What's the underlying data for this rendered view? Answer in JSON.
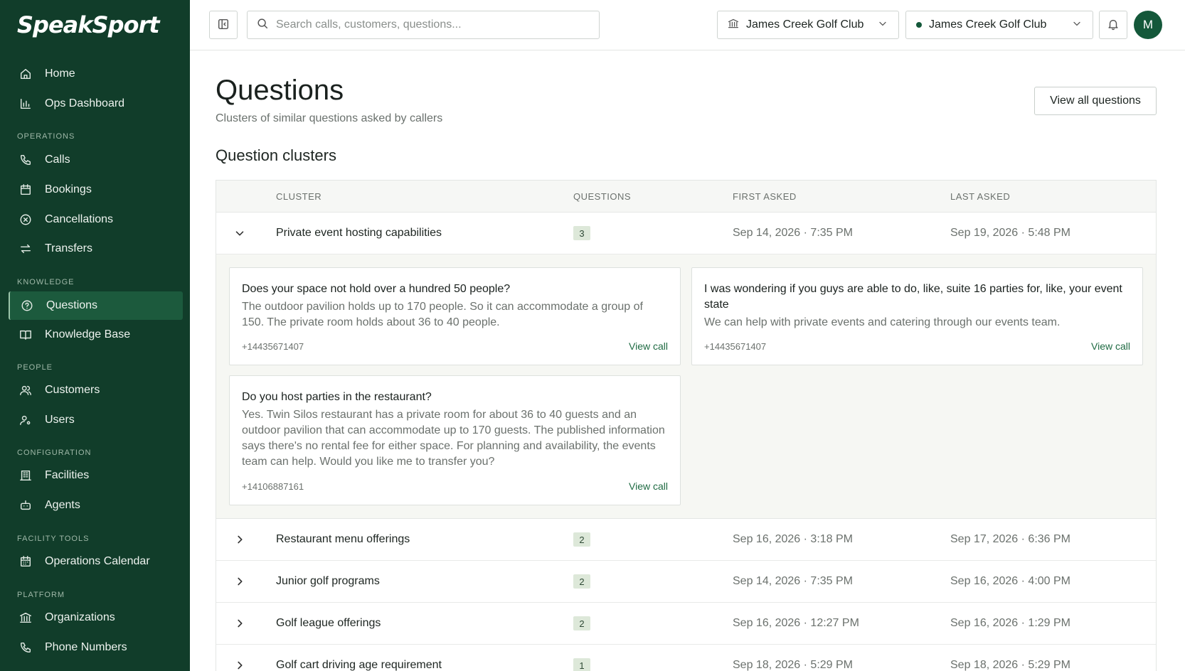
{
  "sidebar": {
    "logo": "SpeakSport",
    "items": [
      {
        "label": "Home",
        "icon": "home-icon"
      },
      {
        "label": "Ops Dashboard",
        "icon": "chart-icon"
      },
      {
        "label": "Calls",
        "icon": "phone-icon"
      },
      {
        "label": "Bookings",
        "icon": "calendar-icon"
      },
      {
        "label": "Cancellations",
        "icon": "x-circle-icon"
      },
      {
        "label": "Transfers",
        "icon": "arrows-icon"
      },
      {
        "label": "Questions",
        "icon": "question-icon"
      },
      {
        "label": "Knowledge Base",
        "icon": "book-icon"
      },
      {
        "label": "Customers",
        "icon": "users-icon"
      },
      {
        "label": "Users",
        "icon": "user-gear-icon"
      },
      {
        "label": "Facilities",
        "icon": "building-icon"
      },
      {
        "label": "Agents",
        "icon": "robot-icon"
      },
      {
        "label": "Operations Calendar",
        "icon": "calendar-grid-icon"
      },
      {
        "label": "Organizations",
        "icon": "bank-icon"
      },
      {
        "label": "Phone Numbers",
        "icon": "phone-icon"
      }
    ],
    "sections": {
      "operations": "OPERATIONS",
      "knowledge": "KNOWLEDGE",
      "people": "PEOPLE",
      "configuration": "CONFIGURATION",
      "facility_tools": "FACILITY TOOLS",
      "platform": "PLATFORM"
    }
  },
  "topbar": {
    "search_placeholder": "Search calls, customers, questions...",
    "org_select": "James Creek Golf Club",
    "facility_select": "James Creek Golf Club",
    "avatar_initial": "M"
  },
  "page": {
    "title": "Questions",
    "subtitle": "Clusters of similar questions asked by callers",
    "view_all": "View all questions",
    "section_title": "Question clusters"
  },
  "table": {
    "headers": {
      "cluster": "CLUSTER",
      "questions": "QUESTIONS",
      "first": "FIRST ASKED",
      "last": "LAST ASKED"
    },
    "rows": [
      {
        "name": "Private event hosting capabilities",
        "count": "3",
        "first": "Sep 14, 2026 · 7:35 PM",
        "last": "Sep 19, 2026 · 5:48 PM"
      },
      {
        "name": "Restaurant menu offerings",
        "count": "2",
        "first": "Sep 16, 2026 · 3:18 PM",
        "last": "Sep 17, 2026 · 6:36 PM"
      },
      {
        "name": "Junior golf programs",
        "count": "2",
        "first": "Sep 14, 2026 · 7:35 PM",
        "last": "Sep 16, 2026 · 4:00 PM"
      },
      {
        "name": "Golf league offerings",
        "count": "2",
        "first": "Sep 16, 2026 · 12:27 PM",
        "last": "Sep 16, 2026 · 1:29 PM"
      },
      {
        "name": "Golf cart driving age requirement",
        "count": "1",
        "first": "Sep 18, 2026 · 5:29 PM",
        "last": "Sep 18, 2026 · 5:29 PM"
      }
    ],
    "expanded_questions": [
      {
        "question": "Does your space not hold over a hundred 50 people?",
        "answer": "The outdoor pavilion holds up to 170 people. So it can accommodate a group of 150. The private room holds about 36 to 40 people.",
        "phone": "+14435671407",
        "link": "View call"
      },
      {
        "question": "I was wondering if you guys are able to do, like, suite 16 parties for, like, your event state",
        "answer": "We can help with private events and catering through our events team.",
        "phone": "+14435671407",
        "link": "View call"
      },
      {
        "question": "Do you host parties in the restaurant?",
        "answer": "Yes. Twin Silos restaurant has a private room for about 36 to 40 guests and an outdoor pavilion that can accommodate up to 170 guests. The published information says there's no rental fee for either space. For planning and availability, the events team can help. Would you like me to transfer you?",
        "phone": "+14106887161",
        "link": "View call"
      }
    ]
  }
}
